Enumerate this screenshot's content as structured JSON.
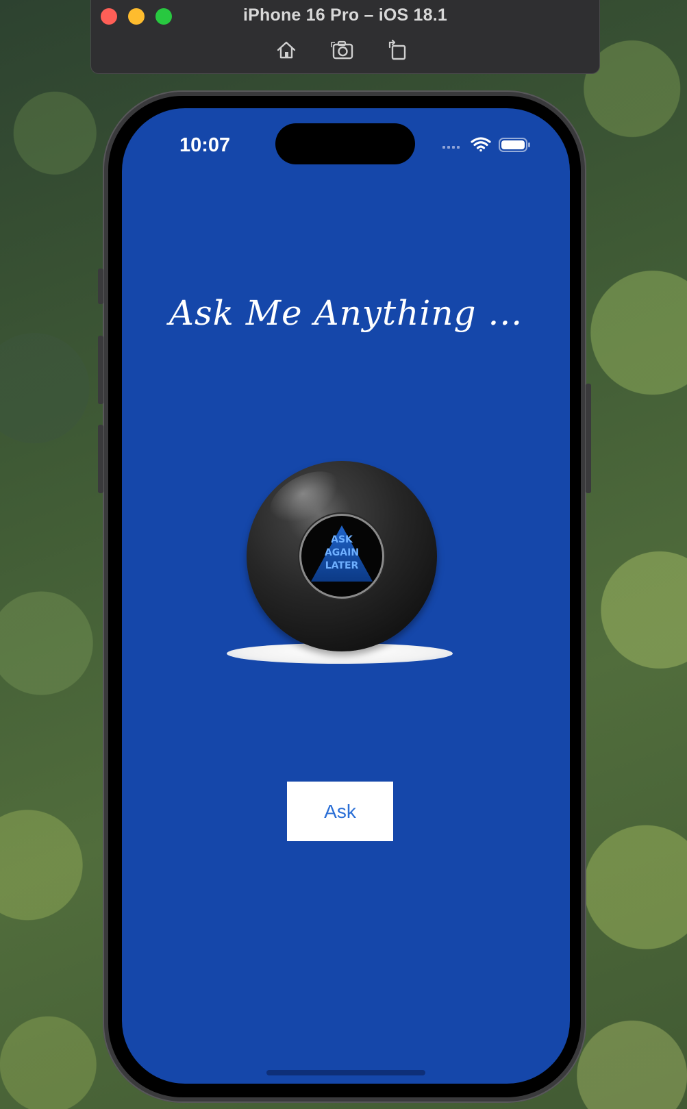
{
  "simulator": {
    "title": "iPhone 16 Pro – iOS 18.1",
    "toolbar": [
      "home-icon",
      "screenshot-icon",
      "rotate-icon"
    ]
  },
  "status_bar": {
    "time": "10:07",
    "icons": [
      "cellular-icon",
      "wifi-icon",
      "battery-icon"
    ]
  },
  "app": {
    "background_color": "#1547aa",
    "title": "Ask Me Anything ...",
    "ball_answer": [
      "ASK",
      "AGAIN",
      "LATER"
    ],
    "ask_button_label": "Ask",
    "ask_button_color": "#2b6fd6"
  }
}
